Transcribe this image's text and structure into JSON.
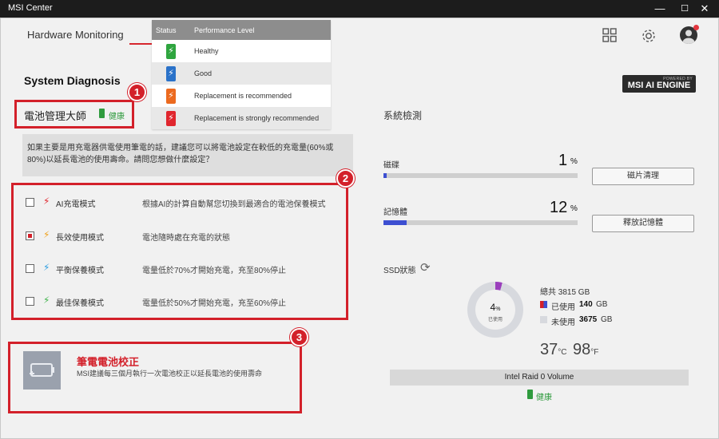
{
  "window": {
    "title": "MSI Center",
    "min": "—",
    "max": "☐",
    "close": "✕"
  },
  "nav": {
    "title": "Hardware Monitoring"
  },
  "engine": {
    "powered_by": "POWERED BY",
    "name": "MSI AI ENGINE"
  },
  "legend": {
    "col_status": "Status",
    "col_level": "Performance Level",
    "rows": [
      {
        "label": "Healthy",
        "color": "#2fa53f"
      },
      {
        "label": "Good",
        "color": "#2a72c9"
      },
      {
        "label": "Replacement is recommended",
        "color": "#ec6a1f"
      },
      {
        "label": "Replacement is strongly recommended",
        "color": "#e0262e"
      }
    ]
  },
  "diagnosis": {
    "title": "System Diagnosis",
    "battery_manager": "電池管理大師",
    "health": "健康",
    "question": "如果主要是用充電器供電使用筆電的話，建議您可以將電池設定在較低的充電量(60%或80%)以延長電池的使用壽命。請問您想做什麼設定？"
  },
  "callouts": [
    "1",
    "2",
    "3"
  ],
  "modes": [
    {
      "name": "AI充電模式",
      "desc": "根據AI的計算自動幫您切換到最適合的電池保養模式",
      "checked": false,
      "bolt_color": "#e0262e"
    },
    {
      "name": "長效使用模式",
      "desc": "電池隨時處在充電的狀態",
      "checked": true,
      "bolt_color": "#f0a21c"
    },
    {
      "name": "平衡保養模式",
      "desc": "電量低於70%才開始充電，充至80%停止",
      "checked": false,
      "bolt_color": "#2a9de0"
    },
    {
      "name": "最佳保養模式",
      "desc": "電量低於50%才開始充電，充至60%停止",
      "checked": false,
      "bolt_color": "#3fb34a"
    }
  ],
  "calibration": {
    "title": "筆電電池校正",
    "desc": "MSI建議每三個月執行一次電池校正以延長電池的使用壽命"
  },
  "system_check": {
    "title": "系統檢測",
    "disk": {
      "label": "磁碟",
      "value": "1",
      "unit": "%",
      "percent": 1,
      "button": "磁片清理"
    },
    "memory": {
      "label": "記憶體",
      "value": "12",
      "unit": "%",
      "percent": 12,
      "button": "釋放記憶體"
    }
  },
  "ssd": {
    "label": "SSD狀態",
    "used_pct": "4",
    "used_pct_unit": "%",
    "used_caption": "已使用",
    "total": "總共 3815 GB",
    "used_label": "已使用",
    "used_value": "140",
    "free_label": "未使用",
    "free_value": "3675",
    "unit": "GB",
    "temp_c": "37",
    "temp_c_unit": "°C",
    "temp_f": "98",
    "temp_f_unit": "°F",
    "volume": "Intel Raid 0 Volume",
    "health": "健康",
    "used_color": "#9a3fbc",
    "free_color": "#d7d9de"
  }
}
